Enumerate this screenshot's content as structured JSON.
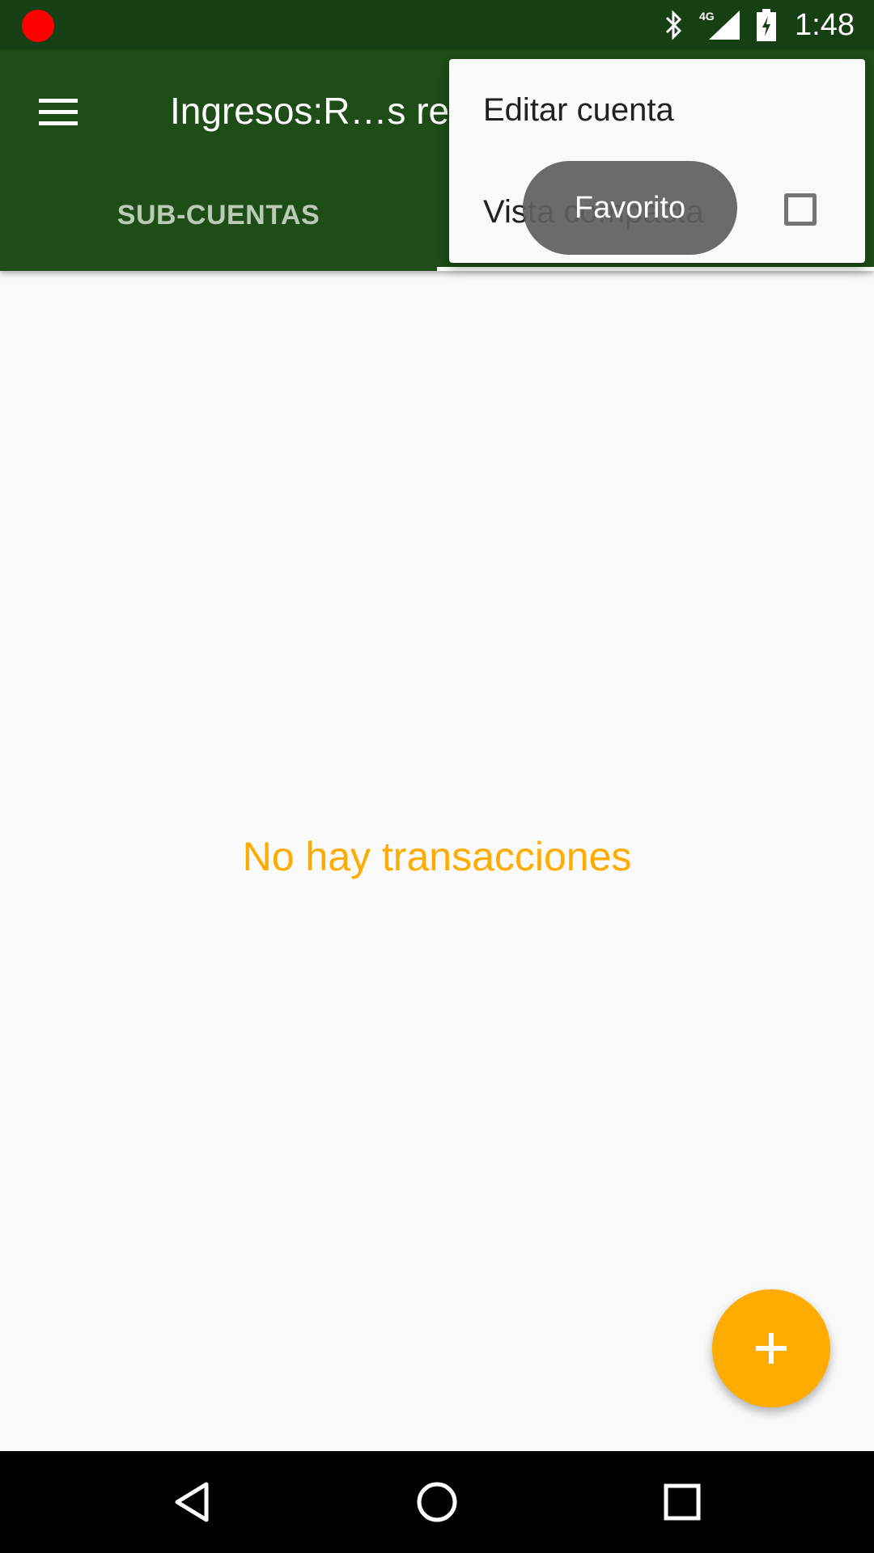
{
  "status_bar": {
    "time": "1:48",
    "network_label": "4G",
    "recording_color": "#ff0000",
    "icons": [
      "bluetooth-icon",
      "signal-4g-icon",
      "battery-charging-icon"
    ]
  },
  "app_bar": {
    "title": "Ingresos:R…s rec",
    "menu_icon": "hamburger-menu-icon",
    "background_color": "#1e4d18"
  },
  "tabs": [
    {
      "label": "SUB-CUENTAS",
      "selected": false
    }
  ],
  "overflow_menu": {
    "items": [
      {
        "label": "Editar cuenta"
      },
      {
        "label": "Vista compacta",
        "checkbox": true,
        "checked": false
      }
    ]
  },
  "tooltip": {
    "text": "Favorito"
  },
  "main": {
    "empty_message": "No hay transacciones",
    "accent_color": "#ffab00"
  },
  "fab": {
    "icon": "plus-icon"
  },
  "nav_bar": {
    "icons": [
      "back-icon",
      "home-icon",
      "recents-icon"
    ]
  }
}
